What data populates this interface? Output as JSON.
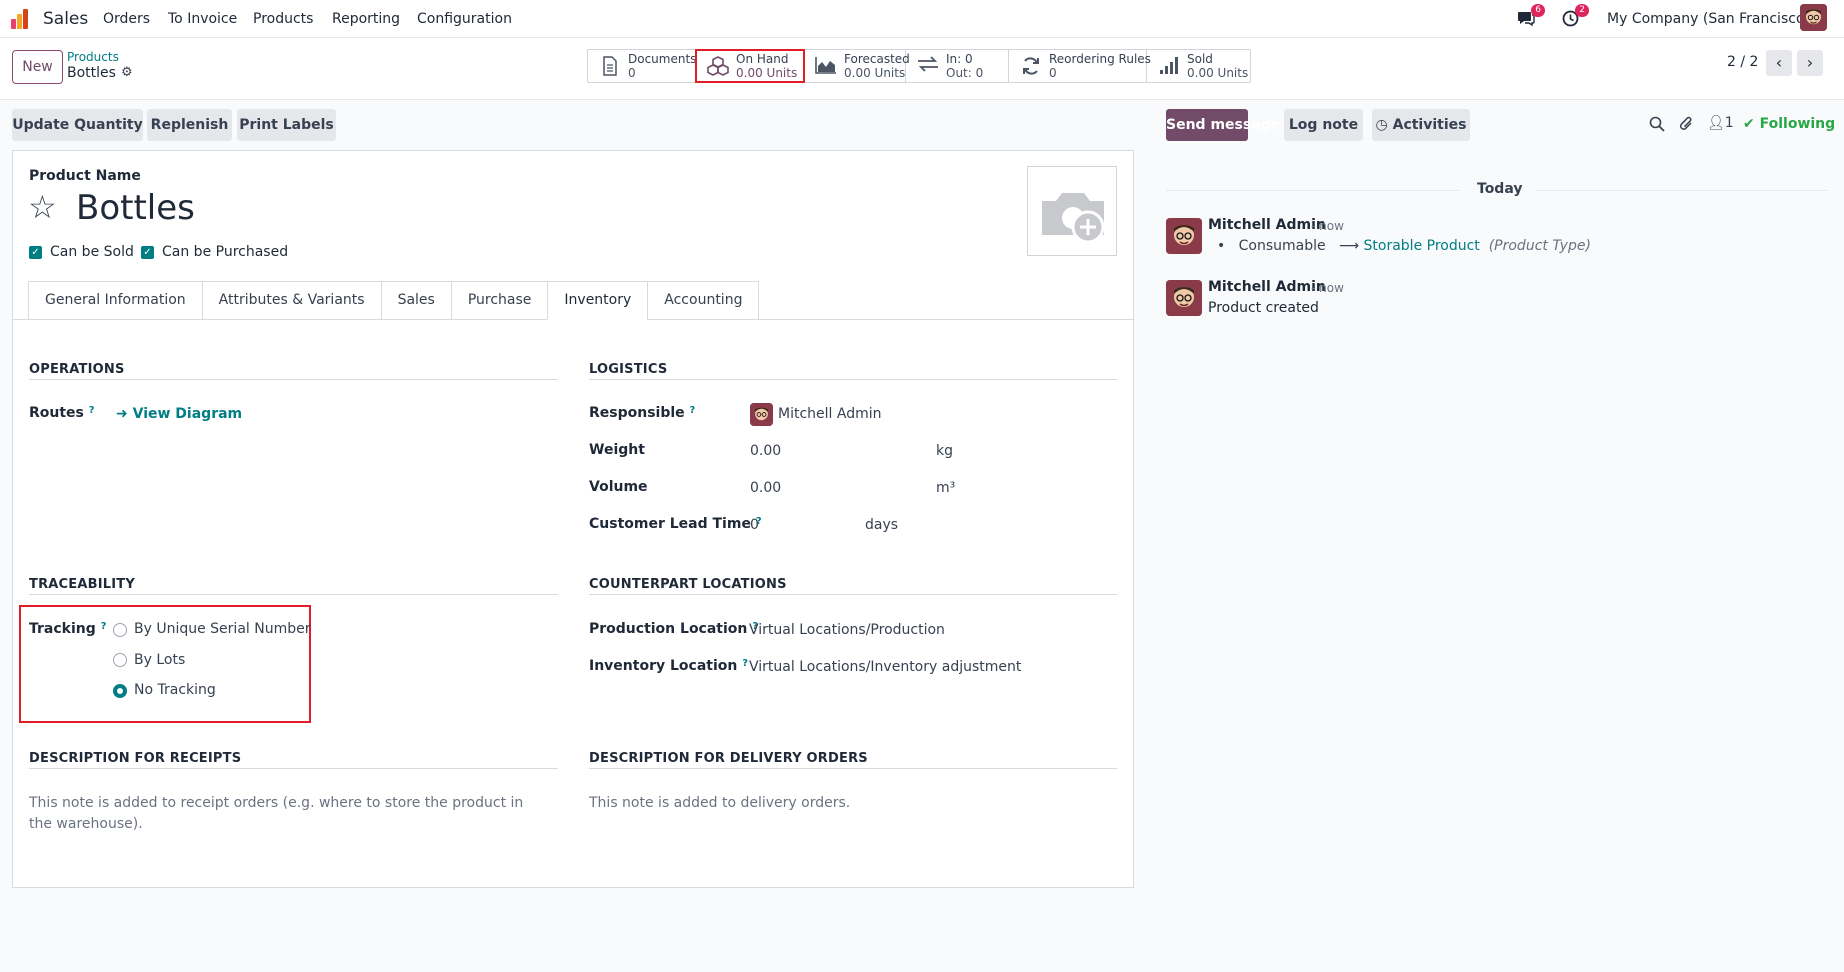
{
  "topnav": {
    "app_name": "Sales",
    "menu": [
      "Orders",
      "To Invoice",
      "Products",
      "Reporting",
      "Configuration"
    ],
    "messages_badge": "6",
    "activities_badge": "2",
    "company": "My Company (San Francisco)"
  },
  "control": {
    "new_label": "New",
    "breadcrumb_parent": "Products",
    "breadcrumb_current": "Bottles",
    "pager": "2 / 2"
  },
  "stats": [
    {
      "label": "Documents",
      "value": "0",
      "icon": "document-icon"
    },
    {
      "label": "On Hand",
      "value": "0.00 Units",
      "icon": "cubes-icon"
    },
    {
      "label": "Forecasted",
      "value": "0.00 Units",
      "icon": "area-chart-icon"
    },
    {
      "label": "In: 0",
      "value": "Out: 0",
      "icon": "exchange-icon"
    },
    {
      "label": "Reordering Rules",
      "value": "0",
      "icon": "refresh-icon"
    },
    {
      "label": "Sold",
      "value": "0.00 Units",
      "icon": "signal-icon"
    }
  ],
  "actions": [
    "Update Quantity",
    "Replenish",
    "Print Labels"
  ],
  "form": {
    "name_label": "Product Name",
    "name": "Bottles",
    "can_be_sold": "Can be Sold",
    "can_be_purchased": "Can be Purchased"
  },
  "tabs": [
    "General Information",
    "Attributes & Variants",
    "Sales",
    "Purchase",
    "Inventory",
    "Accounting"
  ],
  "inventory": {
    "operations_title": "OPERATIONS",
    "routes_label": "Routes",
    "help_mark": "?",
    "view_diagram": "View Diagram",
    "logistics_title": "LOGISTICS",
    "responsible_label": "Responsible",
    "responsible_value": "Mitchell Admin",
    "weight_label": "Weight",
    "weight_value": "0.00",
    "weight_unit": "kg",
    "volume_label": "Volume",
    "volume_value": "0.00",
    "volume_unit": "m³",
    "lead_label": "Customer Lead Time",
    "lead_value": "0",
    "lead_unit": "days",
    "traceability_title": "TRACEABILITY",
    "tracking_label": "Tracking",
    "tracking_options": [
      "By Unique Serial Number",
      "By Lots",
      "No Tracking"
    ],
    "tracking_selected": "No Tracking",
    "counterpart_title": "COUNTERPART LOCATIONS",
    "production_label": "Production Location",
    "production_value": "Virtual Locations/Production",
    "inventory_loc_label": "Inventory Location",
    "inventory_loc_value": "Virtual Locations/Inventory adjustment",
    "desc_receipts_title": "DESCRIPTION FOR RECEIPTS",
    "desc_receipts_placeholder": "This note is added to receipt orders (e.g. where to store the product in the warehouse).",
    "desc_delivery_title": "DESCRIPTION FOR DELIVERY ORDERS",
    "desc_delivery_placeholder": "This note is added to delivery orders."
  },
  "chatter": {
    "send_message": "Send message",
    "log_note": "Log note",
    "activities": "Activities",
    "followers_count": "1",
    "following": "Following",
    "today": "Today",
    "messages": [
      {
        "author": "Mitchell Admin",
        "time": "- now",
        "old": "Consumable",
        "new": "Storable Product",
        "field": "(Product Type)"
      },
      {
        "author": "Mitchell Admin",
        "time": "- now",
        "body": "Product created"
      }
    ]
  },
  "colors": {
    "brand": "#714b67",
    "teal": "#017e84",
    "highlight": "#e11d25"
  }
}
